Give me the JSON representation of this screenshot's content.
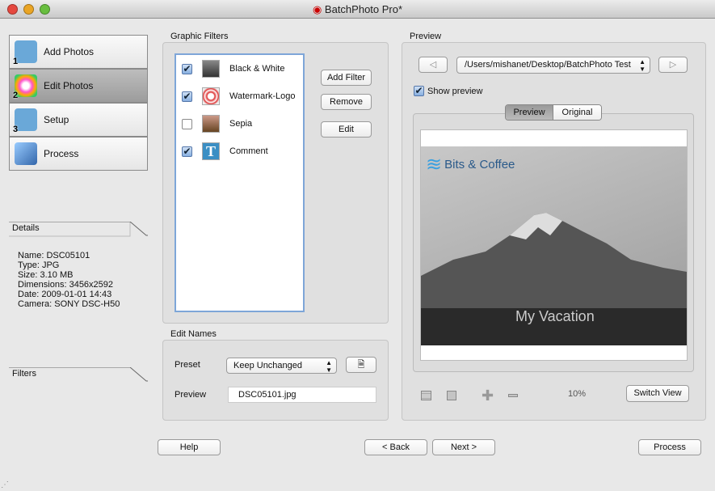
{
  "window": {
    "title": "BatchPhoto Pro*"
  },
  "nav": [
    {
      "label": "Add Photos",
      "num": "1"
    },
    {
      "label": "Edit Photos",
      "num": "2"
    },
    {
      "label": "Setup",
      "num": "3"
    },
    {
      "label": "Process",
      "num": ""
    }
  ],
  "details": {
    "header": "Details",
    "lines": [
      "Name: DSC05101",
      "Type: JPG",
      "Size: 3.10 MB",
      "Dimensions: 3456x2592",
      "Date: 2009-01-01 14:43",
      "Camera: SONY DSC-H50"
    ]
  },
  "filters_header": "Filters",
  "graphic_filters": {
    "label": "Graphic Filters",
    "items": [
      {
        "label": "Black & White",
        "checked": true
      },
      {
        "label": "Watermark-Logo",
        "checked": true
      },
      {
        "label": "Sepia",
        "checked": false
      },
      {
        "label": "Comment",
        "checked": true
      }
    ],
    "add": "Add Filter",
    "remove": "Remove",
    "edit": "Edit"
  },
  "edit_names": {
    "label": "Edit Names",
    "preset_label": "Preset",
    "preset_value": "Keep Unchanged",
    "preview_label": "Preview",
    "preview_value": "DSC05101.jpg"
  },
  "preview": {
    "label": "Preview",
    "path": "/Users/mishanet/Desktop/BatchPhoto Test",
    "show_preview": "Show preview",
    "tabs": [
      "Preview",
      "Original"
    ],
    "logo_text": "Bits & Coffee",
    "caption": "My Vacation",
    "zoom": "10%",
    "switch_view": "Switch View"
  },
  "footer": {
    "help": "Help",
    "back": "< Back",
    "next": "Next >",
    "process": "Process"
  }
}
